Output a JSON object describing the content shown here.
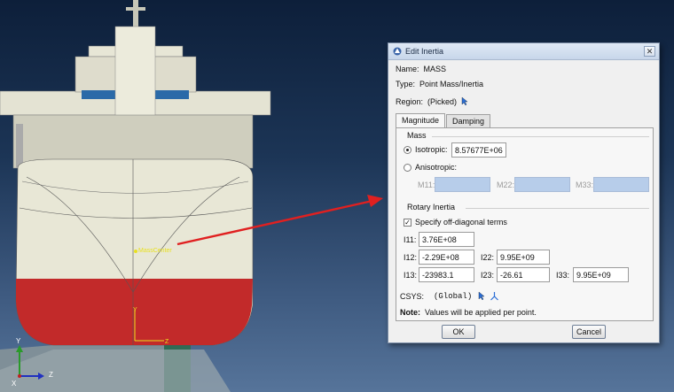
{
  "viewport": {
    "ref_point_label": "MassCenter",
    "axis_y": "Y",
    "axis_z": "Z",
    "axis_x": "X",
    "colors": {
      "hull_top": "#d8d8c8",
      "hull_bottom": "#c22a2a",
      "arrow": "#e02020",
      "sky": "#1c3556"
    }
  },
  "dialog": {
    "title": "Edit Inertia",
    "name_label": "Name:",
    "name_value": "MASS",
    "type_label": "Type:",
    "type_value": "Point Mass/Inertia",
    "region_label": "Region:",
    "region_value": "(Picked)",
    "tabs": [
      {
        "label": "Magnitude"
      },
      {
        "label": "Damping"
      }
    ],
    "mass": {
      "group_label": "Mass",
      "isotropic_label": "Isotropic:",
      "isotropic_value": "8.57677E+06",
      "anisotropic_label": "Anisotropic:",
      "m11_label": "M11:",
      "m22_label": "M22:",
      "m33_label": "M33:"
    },
    "rotary": {
      "group_label": "Rotary Inertia",
      "offdiag_label": "Specify off-diagonal terms",
      "i11_label": "I11:",
      "i11_value": "3.76E+08",
      "i12_label": "I12:",
      "i12_value": "-2.29E+08",
      "i22_label": "I22:",
      "i22_value": "9.95E+09",
      "i13_label": "I13:",
      "i13_value": "-23983.1",
      "i23_label": "I23:",
      "i23_value": "-26.61",
      "i33_label": "I33:",
      "i33_value": "9.95E+09"
    },
    "csys_label": "CSYS:",
    "csys_value": "(Global)",
    "note_label": "Note:",
    "note_text": "Values will be applied per point.",
    "ok_label": "OK",
    "cancel_label": "Cancel"
  }
}
